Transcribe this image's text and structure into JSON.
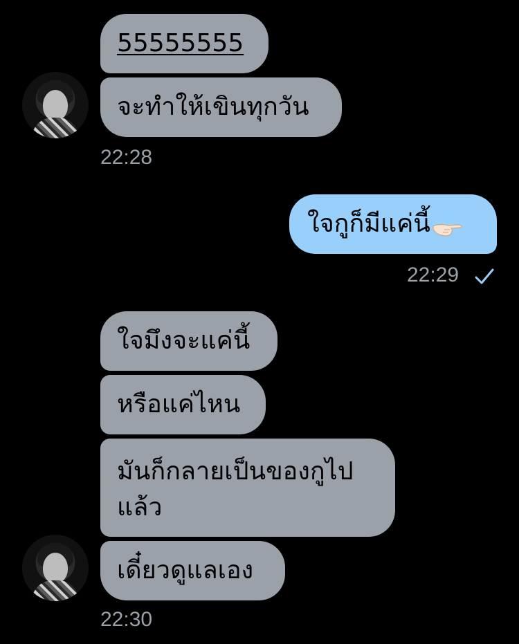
{
  "chat": {
    "group1": {
      "messages": [
        "55555555",
        "จะทำให้เขินทุกวัน"
      ],
      "time": "22:28"
    },
    "group2": {
      "message": "ใจกูก็มีแค่นี้",
      "emoji": "pointing-hand-emoji",
      "time": "22:29",
      "status_icon": "check-icon"
    },
    "group3": {
      "messages": [
        "ใจมึงจะแค่นี้",
        "หรือแค่ไหน",
        "มันก็กลายเป็นของกูไป",
        "แล้ว",
        "เดี๋ยวดูแลเอง"
      ],
      "time": "22:30"
    }
  },
  "colors": {
    "background": "#000000",
    "incoming_bubble": "#9aa1a9",
    "outgoing_bubble": "#98d0fb",
    "timestamp": "#9aa1a9",
    "check": "#98d0fb"
  }
}
